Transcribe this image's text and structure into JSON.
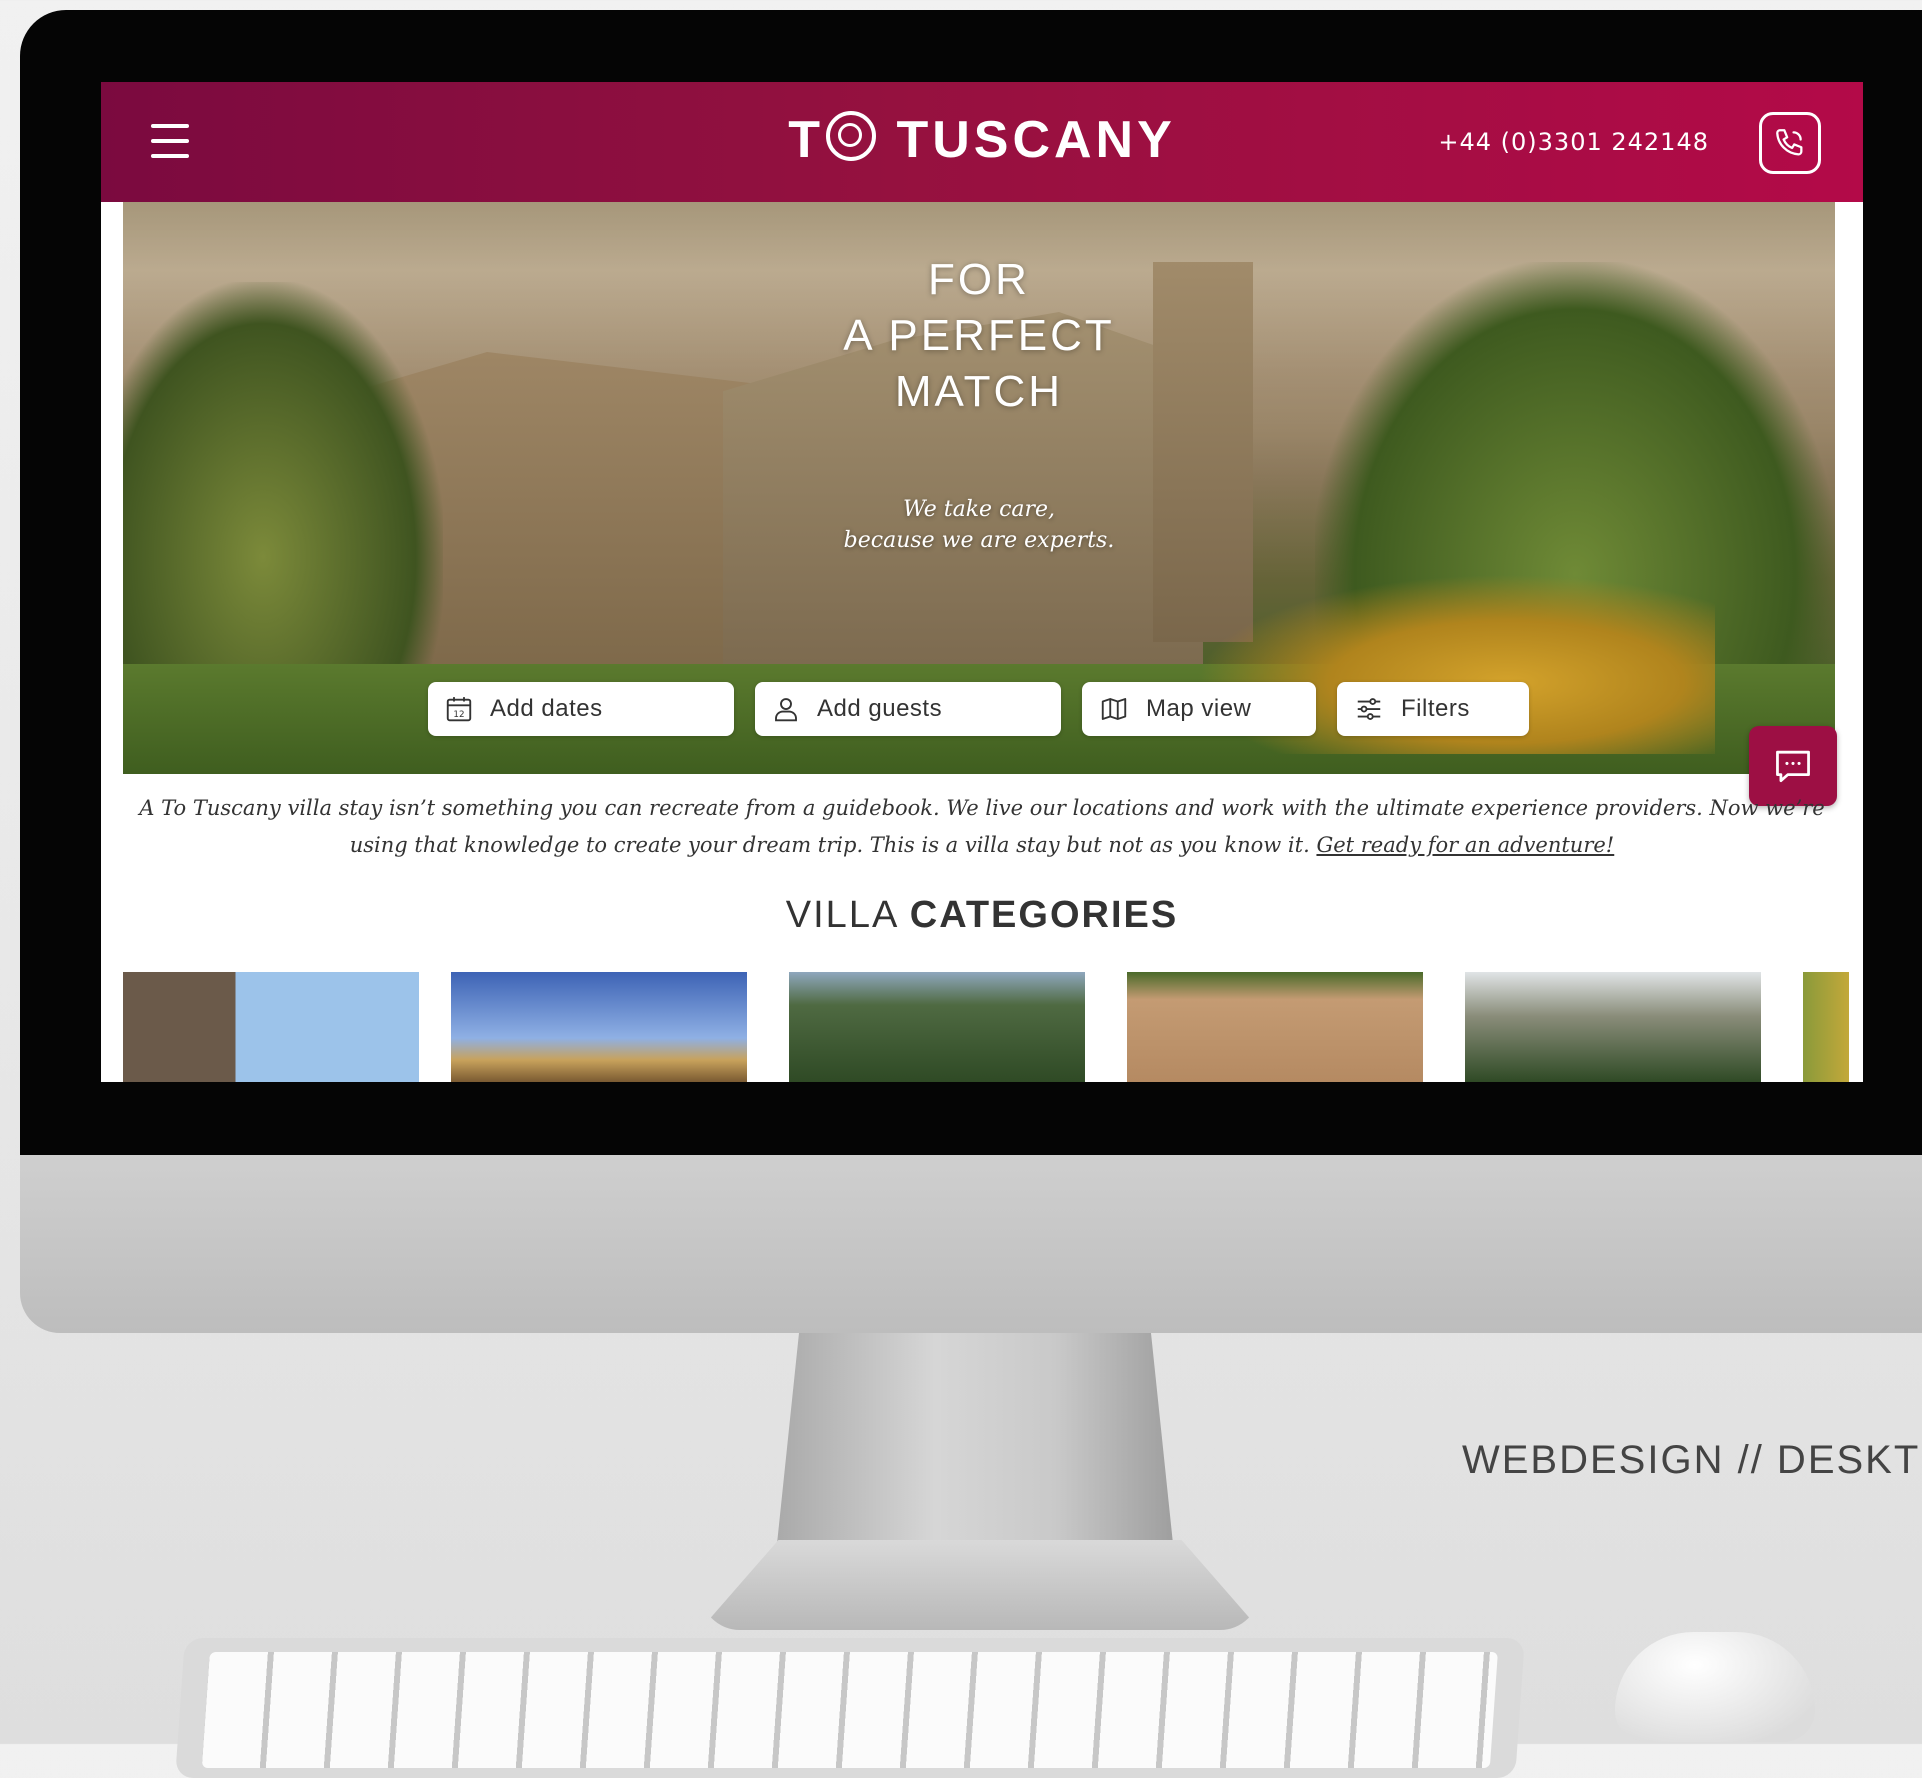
{
  "site": {
    "logo_prefix": "T",
    "logo_suffix": "TUSCANY",
    "phone_number": "+44 (0)3301 242148"
  },
  "hero": {
    "title": "FOR\nA PERFECT\nMATCH",
    "subtitle": "We take care,\nbecause we are experts."
  },
  "search": {
    "dates_label": "Add dates",
    "dates_icon_day": "12",
    "guests_label": "Add guests",
    "map_label": "Map view",
    "filters_label": "Filters"
  },
  "intro": {
    "text": "A To Tuscany villa stay isn’t something you can recreate from a guidebook. We live our locations and work with the ultimate experience providers. Now we’re using that knowledge to create your dream trip. This is a villa stay but not as you know it.",
    "link": "Get ready for an adventure!"
  },
  "categories": {
    "title_light": "VILLA",
    "title_bold": "CATEGORIES"
  },
  "caption": "WEBDESIGN // DESKT",
  "colors": {
    "brand": "#9d0f44",
    "header_start": "#7b0a3f",
    "header_end": "#b30a48"
  },
  "icons": [
    "hamburger-menu-icon",
    "phone-icon",
    "calendar-icon",
    "user-icon",
    "map-icon",
    "sliders-icon",
    "chat-icon"
  ]
}
